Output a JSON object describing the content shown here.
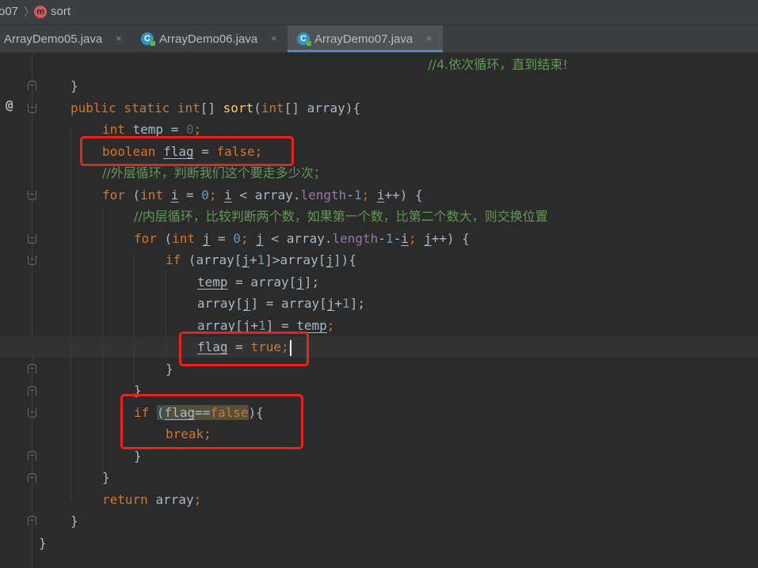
{
  "breadcrumb": {
    "project": "o07",
    "separator": "〉",
    "method_icon": "m",
    "method": "sort"
  },
  "tabs": [
    {
      "label": "ArrayDemo05.java",
      "close": "×"
    },
    {
      "label": "ArrayDemo06.java",
      "close": "×",
      "icon": "C"
    },
    {
      "label": "ArrayDemo07.java",
      "close": "×",
      "icon": "C",
      "active": true
    }
  ],
  "gutter": {
    "override_marker": "@"
  },
  "code": {
    "l0": "//4.依次循环，直到结束!",
    "l1": "}",
    "l2a": "public static ",
    "l2b": "int",
    "l2c": "[] ",
    "l2d": "sort",
    "l2e": "(",
    "l2f": "int",
    "l2g": "[] array){",
    "l3a": "int ",
    "l3b": "temp",
    "l3c": " = ",
    "l3d": "0",
    "l3e": ";",
    "l4a": "boolean ",
    "l4b": "flag",
    "l4c": " = ",
    "l4d": "false",
    "l4e": ";",
    "l5": "//外层循环，判断我们这个要走多少次；",
    "l6a": "for ",
    "l6b": "(",
    "l6c": "int ",
    "l6d": "i",
    "l6e": " = ",
    "l6f": "0",
    "l6g": "; ",
    "l6h": "i",
    "l6i": " < array.",
    "l6j": "length",
    "l6k": "-",
    "l6l": "1",
    "l6m": "; ",
    "l6n": "i",
    "l6o": "++) {",
    "l7": "//内层循环，比较判断两个数，如果第一个数，比第二个数大，则交换位置",
    "l8a": "for ",
    "l8b": "(",
    "l8c": "int ",
    "l8d": "j",
    "l8e": " = ",
    "l8f": "0",
    "l8g": "; ",
    "l8h": "j",
    "l8i": " < array.",
    "l8j": "length",
    "l8k": "-",
    "l8l": "1",
    "l8m": "-",
    "l8n": "i",
    "l8o": "; ",
    "l8p": "j",
    "l8q": "++) {",
    "l9a": "if ",
    "l9b": "(array[",
    "l9c": "j",
    "l9d": "+",
    "l9e": "1",
    "l9f": "]>array[",
    "l9g": "j",
    "l9h": "]){",
    "l10a": "temp",
    "l10b": " = array[",
    "l10c": "j",
    "l10d": "];",
    "l11a": "array[",
    "l11b": "j",
    "l11c": "] = array[",
    "l11d": "j",
    "l11e": "+",
    "l11f": "1",
    "l11g": "];",
    "l12a": "array[",
    "l12b": "j",
    "l12c": "+",
    "l12d": "1",
    "l12e": "] = ",
    "l12f": "temp",
    "l12g": ";",
    "l13a": "flag",
    "l13b": " = ",
    "l13c": "true",
    "l13d": ";",
    "l14": "}",
    "l15": "}",
    "l16a": "if ",
    "l16b": "(",
    "l16c": "flag",
    "l16d": "==",
    "l16e": "false",
    "l16f": "){",
    "l17a": "break",
    "l17b": ";",
    "l18": "}",
    "l19": "}",
    "l20a": "return ",
    "l20b": "array",
    "l20c": ";",
    "l21": "}",
    "l22": "}"
  },
  "colors": {
    "background": "#2b2b2b",
    "keyword": "#cc7832",
    "number": "#6897bb",
    "comment": "#629755",
    "method": "#ffc66d",
    "field": "#9876aa",
    "text": "#a9b7c6",
    "annotation_box": "#e8231e"
  }
}
